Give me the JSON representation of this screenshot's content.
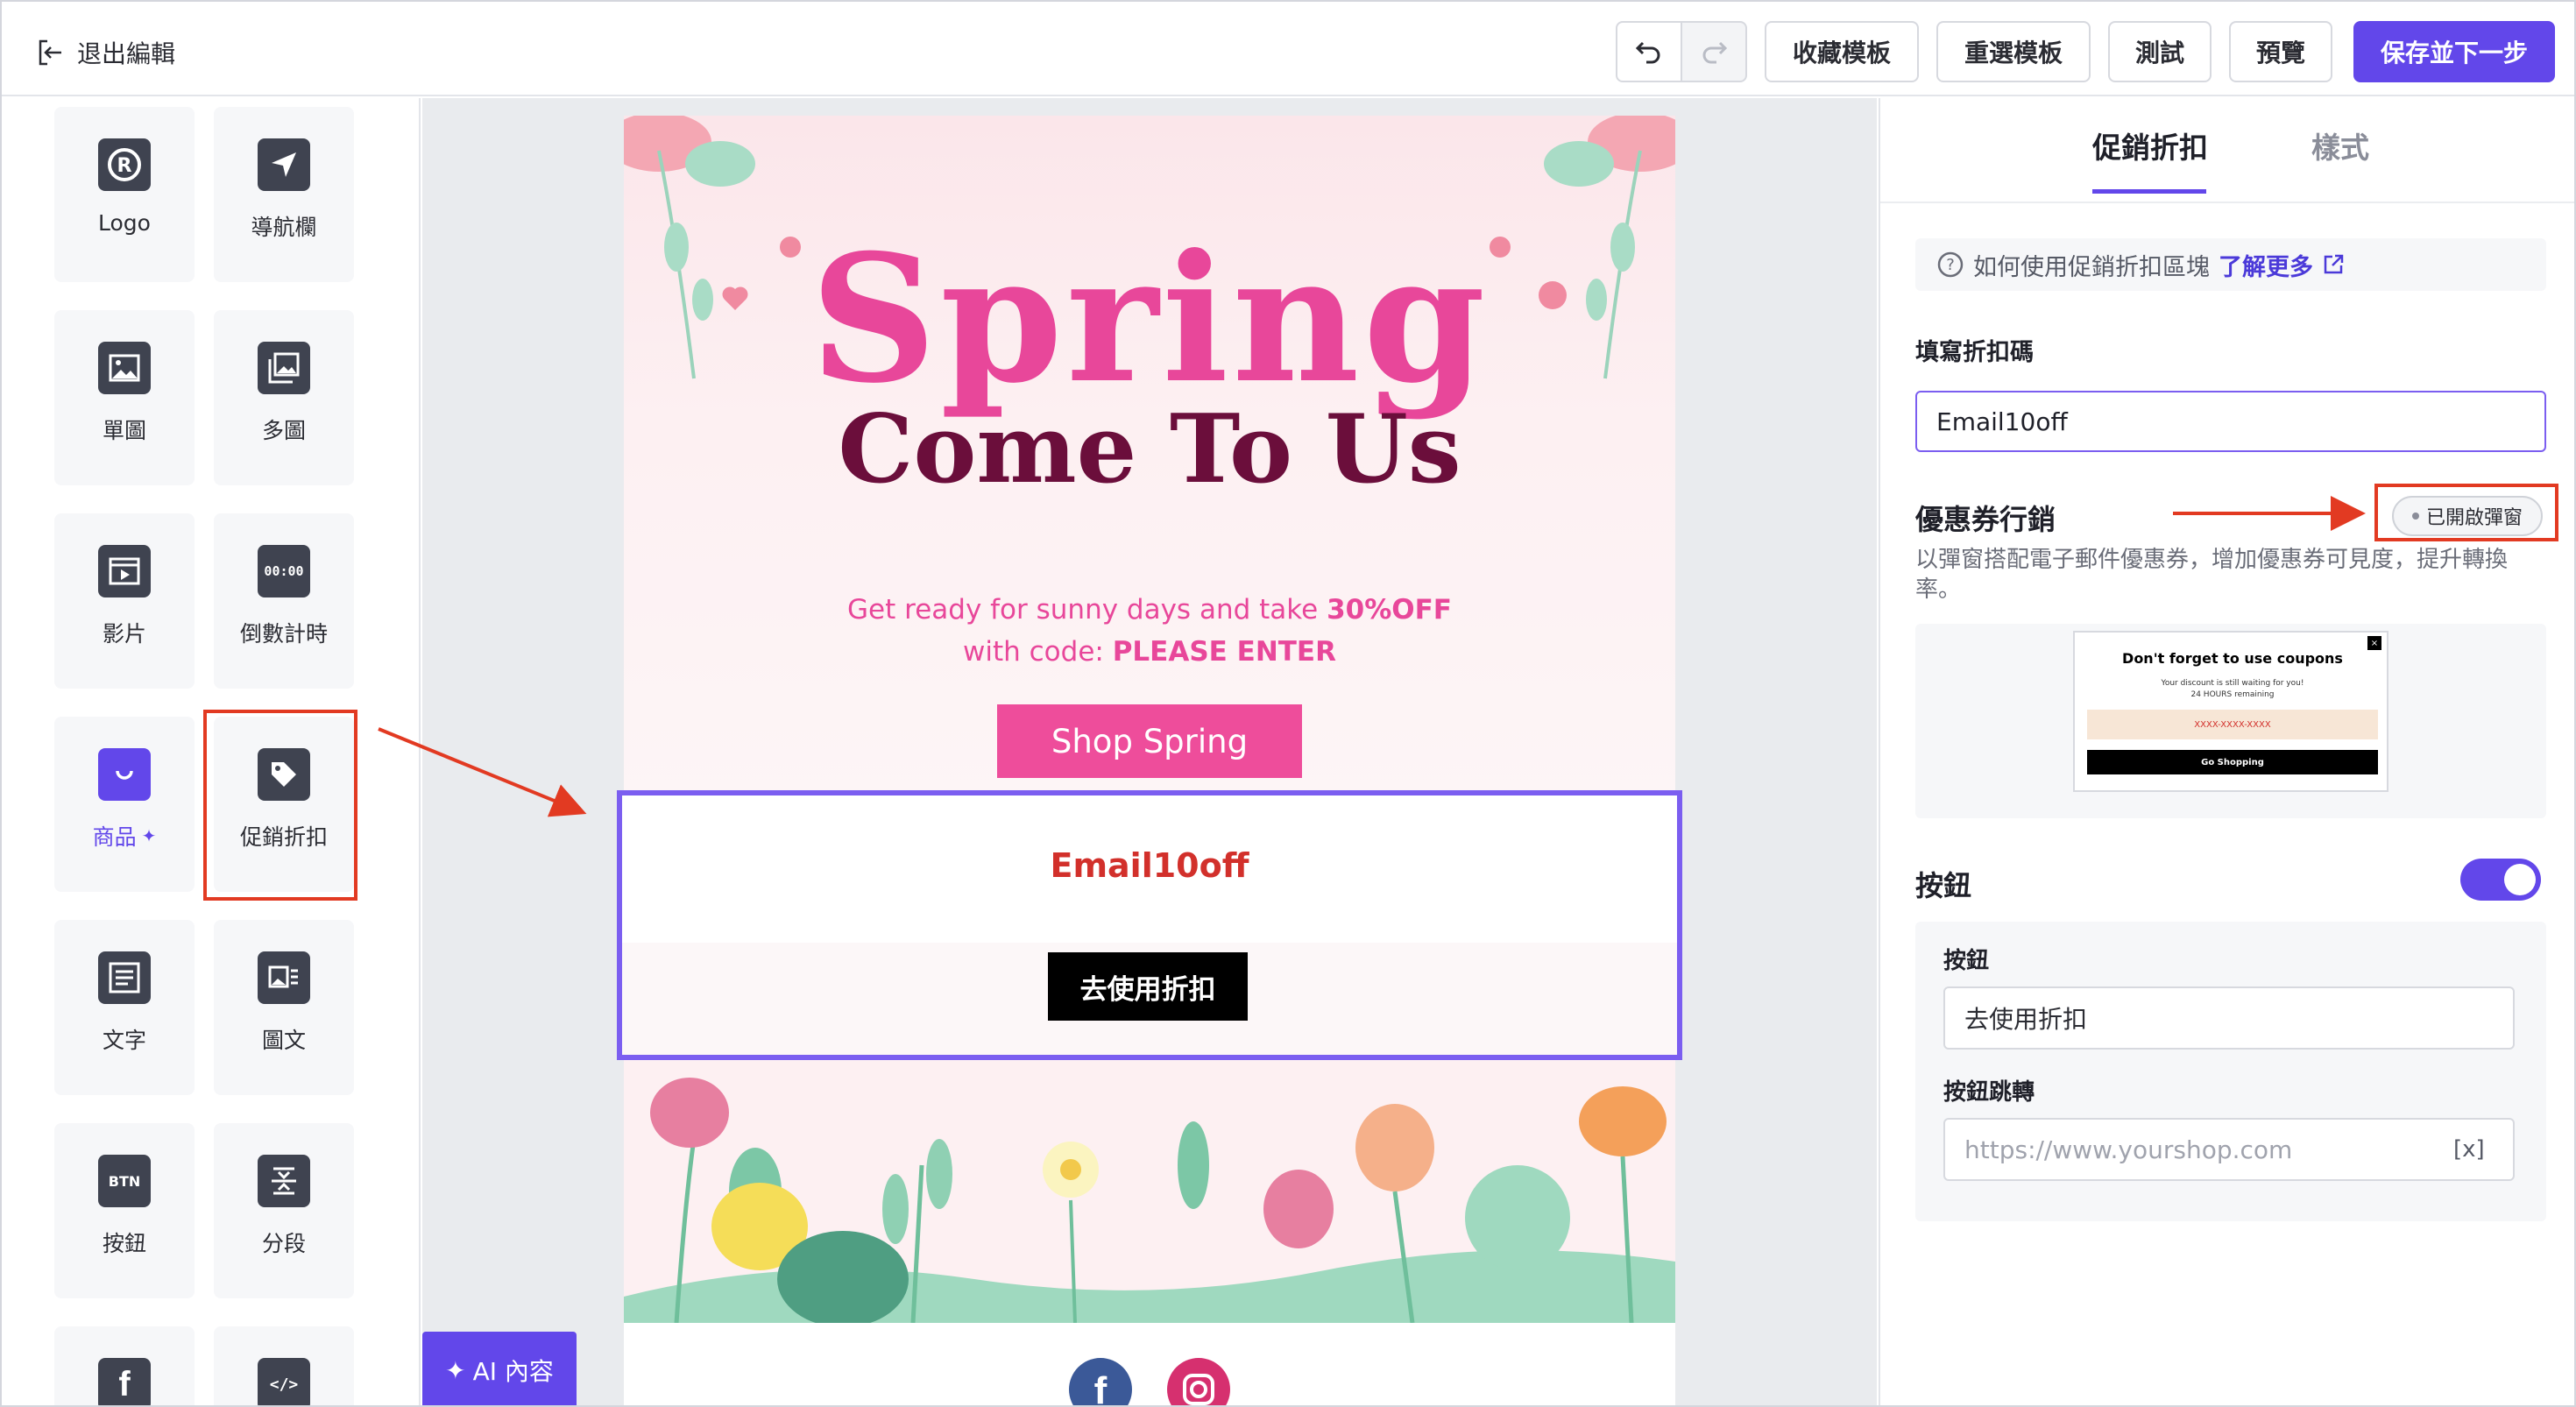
{
  "toolbar": {
    "exit_label": "退出編輯",
    "save_template": "收藏模板",
    "reselect_template": "重選模板",
    "test": "測試",
    "preview": "預覽",
    "save_next": "保存並下一步"
  },
  "blocks": [
    {
      "label": "Logo",
      "icon": "logo-icon"
    },
    {
      "label": "導航欄",
      "icon": "navigation-icon"
    },
    {
      "label": "單圖",
      "icon": "image-icon"
    },
    {
      "label": "多圖",
      "icon": "images-icon"
    },
    {
      "label": "影片",
      "icon": "video-icon"
    },
    {
      "label": "倒數計時",
      "icon": "countdown-icon"
    },
    {
      "label": "商品",
      "icon": "shopping-bag-icon"
    },
    {
      "label": "促銷折扣",
      "icon": "tag-icon"
    },
    {
      "label": "文字",
      "icon": "text-icon"
    },
    {
      "label": "圖文",
      "icon": "image-text-icon"
    },
    {
      "label": "按鈕",
      "icon": "button-icon"
    },
    {
      "label": "分段",
      "icon": "divider-icon"
    }
  ],
  "block_icon_text": {
    "countdown": "00:00",
    "button": "BTN"
  },
  "email": {
    "title_spring": "Spring",
    "title_come": "Come To Us",
    "promo_prefix": "Get ready for sunny days and take",
    "promo_off": "30%OFF",
    "promo_code_prefix": "with code:",
    "promo_code": "PLEASE ENTER",
    "shop_button": "Shop Spring",
    "coupon_code": "Email10off",
    "coupon_button": "去使用折扣"
  },
  "ai_button": "AI 內容",
  "panel": {
    "tab_promo": "促銷折扣",
    "tab_style": "樣式",
    "help_text": "如何使用促銷折扣區塊",
    "help_link": "了解更多",
    "code_label": "填寫折扣碼",
    "code_value": "Email10off",
    "coupon_title": "優惠券行銷",
    "popup_badge": "已開啟彈窗",
    "coupon_desc": "以彈窗搭配電子郵件優惠券，增加優惠券可見度，提升轉換率。",
    "preview_title": "Don't forget to use coupons",
    "preview_sub_1": "Your discount is still waiting for you!",
    "preview_sub_2": "24 HOURS remaining",
    "preview_code": "XXXX-XXXX-XXXX",
    "preview_button": "Go Shopping",
    "button_section": "按鈕",
    "button_label": "按鈕",
    "button_value": "去使用折扣",
    "redirect_label": "按鈕跳轉",
    "redirect_placeholder": "https://www.yourshop.com",
    "var_icon": "[x]"
  },
  "colors": {
    "accent": "#6247ea",
    "spring_pink": "#e8479a",
    "title_maroon": "#6b0e3b",
    "coupon_red": "#d2302b",
    "annotation_red": "#e23a22"
  }
}
